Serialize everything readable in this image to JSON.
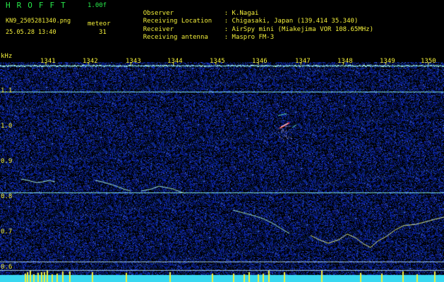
{
  "header": {
    "brand": "HROFFT",
    "version": "1.00f",
    "filename": "KN9_2505281340.png",
    "datetime": "25.05.28 13:40",
    "count_label": "meteor",
    "count_value": "31"
  },
  "info": [
    {
      "key": "Observer",
      "value": ": K.Nagai"
    },
    {
      "key": "Receiving Location",
      "value": ": Chigasaki, Japan (139.414 35.340)"
    },
    {
      "key": "Receiver",
      "value": ": AirSpy mini (Miakejima VOR 108.65MHz)"
    },
    {
      "key": "Receiving antenna",
      "value": ": Maspro FM-3"
    }
  ],
  "y_axis": {
    "unit": "kHz",
    "ticks": [
      "1.1",
      "1.0",
      "0.9",
      "0.8",
      "0.7",
      "0.6"
    ]
  },
  "x_axis": {
    "ticks": [
      "1341",
      "1342",
      "1343",
      "1344",
      "1345",
      "1346",
      "1347",
      "1348",
      "1349",
      "1350"
    ]
  },
  "colors": {
    "background": "#000000",
    "noise": "#1b2bb5",
    "text_yellow": "#f2ee3a",
    "text_green": "#27e84a",
    "line": "#8fe8e0",
    "bottom_band": "#38d8f0",
    "bar": "#f2ee3a"
  }
}
